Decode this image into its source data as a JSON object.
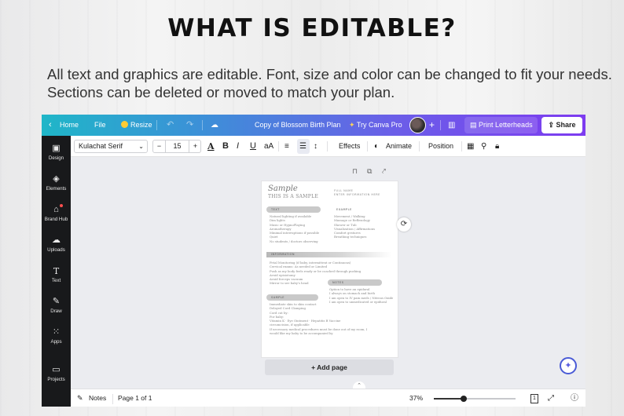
{
  "headline": "WHAT IS EDITABLE?",
  "description": "All text and graphics are editable. Font, size and color can be changed to fit your needs. Sections can be deleted or moved to match your plan.",
  "topbar": {
    "back_icon": "chevron-left-icon",
    "home": "Home",
    "file": "File",
    "resize": "Resize",
    "doc_title": "Copy of Blossom Birth Plan",
    "try_pro": "Try Canva Pro",
    "print": "Print Letterheads",
    "share": "Share"
  },
  "sidebar": {
    "items": [
      {
        "label": "Design",
        "icon": "design-icon"
      },
      {
        "label": "Elements",
        "icon": "elements-icon"
      },
      {
        "label": "Brand Hub",
        "icon": "brand-hub-icon"
      },
      {
        "label": "Uploads",
        "icon": "uploads-icon"
      },
      {
        "label": "Text",
        "icon": "text-icon"
      },
      {
        "label": "Draw",
        "icon": "draw-icon"
      },
      {
        "label": "Apps",
        "icon": "apps-icon"
      },
      {
        "label": "Projects",
        "icon": "projects-icon"
      }
    ]
  },
  "toolbar": {
    "font": "Kulachat Serif",
    "minus": "−",
    "font_size": "15",
    "plus": "+",
    "effects": "Effects",
    "animate": "Animate",
    "position": "Position"
  },
  "page": {
    "script_title": "Sample",
    "subtitle": "THIS IS A SAMPLE",
    "name_label": "FULL NAME",
    "name_sub": "ENTER INFORMATION HERE",
    "sec_text": "TEXT",
    "sec_example": "EXAMPLE",
    "sec_information": "INFORMATION",
    "sec_notes": "NOTES",
    "sec_sample": "SAMPLE",
    "text_lines": [
      "Natural lighting if available",
      "Dim lights",
      "Music or HypnoPlaying",
      "Aromatherapy",
      "Minimal interruptions if possible",
      "Quiet",
      "No students / doctors observing"
    ],
    "example_lines": [
      "Movement / Walking",
      "Massage or Reflexology",
      "Shower or Tub",
      "Visualization / Affirmations",
      "Comfort gestures",
      "Breathing techniques"
    ],
    "info_lines": [
      "Fetal Monitoring (if baby, intermittent or Continuous)",
      "Cervical exams: As needed or Limited",
      "Push as my body feels ready or be coached through pushing",
      "Avoid episiotomy",
      "Avoid forceps vacuum",
      "Mirror to see baby's head"
    ],
    "notes_lines": [
      "Option to have an epidural",
      "I always on stomach and birth",
      "I am open to IV pain meds / Nitrous Oxide",
      "I am open to unmedicated or epidural"
    ],
    "sample_lines": [
      "Immediate skin to skin contact",
      "Delayed Cord Clamping",
      "Cord cut by:",
      "For baby:",
      "    Vitamin K  ·  Eye Ointment  ·  Hepatitis B Vaccine",
      "    circumcision, if applicable",
      "If necessary medical procedures must be done out of my room, I",
      "    would like my baby to be accompanied by"
    ]
  },
  "canvas": {
    "add_page": "+ Add page"
  },
  "bottombar": {
    "notes": "Notes",
    "page_info": "Page 1 of 1",
    "zoom": "37%",
    "zoom_level": 0.37,
    "page_count": "1"
  }
}
